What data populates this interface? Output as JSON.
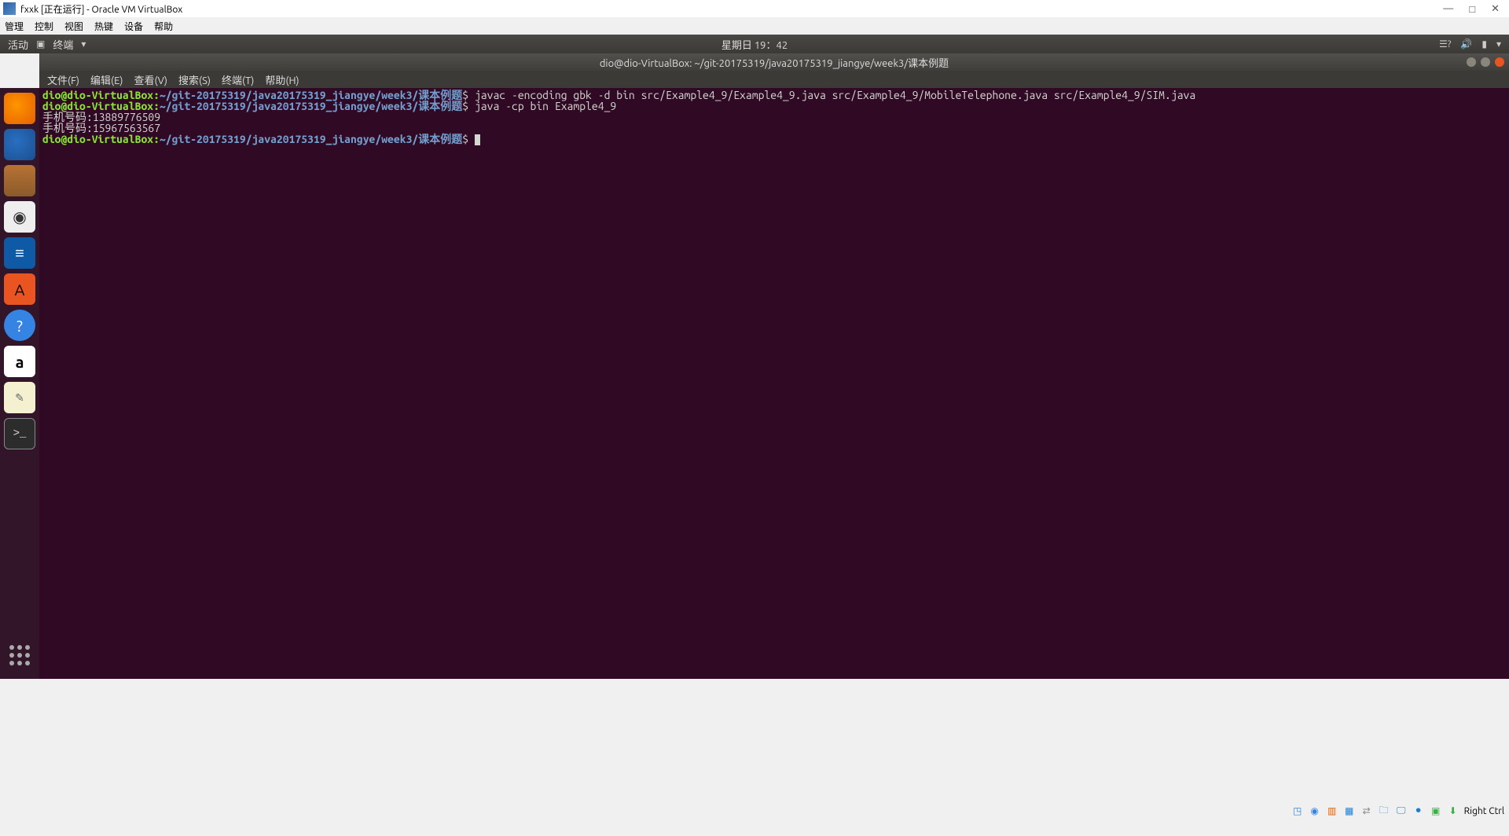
{
  "vbox": {
    "title": "fxxk [正在运行] - Oracle VM VirtualBox",
    "menu": [
      "管理",
      "控制",
      "视图",
      "热键",
      "设备",
      "帮助"
    ],
    "winbtns": {
      "min": "—",
      "max": "□",
      "close": "✕"
    },
    "status_hostkey": "Right Ctrl"
  },
  "ubuntu_topbar": {
    "activities": "活动",
    "appname": "终端",
    "datetime": "星期日 19：42"
  },
  "terminal_window": {
    "title": "dio@dio-VirtualBox: ~/git-20175319/java20175319_jiangye/week3/课本例题",
    "menu": [
      "文件(F)",
      "编辑(E)",
      "查看(V)",
      "搜索(S)",
      "终端(T)",
      "帮助(H)"
    ]
  },
  "prompt": {
    "userhost": "dio@dio-VirtualBox",
    "sep1": ":",
    "path_head": "~/git-20175319/java20175319_jiangye/week3/",
    "path_cjk": "课本例题",
    "sigil": "$"
  },
  "lines": {
    "cmd1": " javac -encoding gbk -d bin src/Example4_9/Example4_9.java src/Example4_9/MobileTelephone.java src/Example4_9/SIM.java",
    "cmd2": " java -cp bin Example4_9",
    "out1": "手机号码:13889776509",
    "out2": "手机号码:15967563567"
  },
  "launcher_icons": [
    "firefox",
    "thunderbird",
    "files",
    "rhythmbox",
    "writer",
    "software",
    "help",
    "amazon",
    "text",
    "terminal"
  ]
}
